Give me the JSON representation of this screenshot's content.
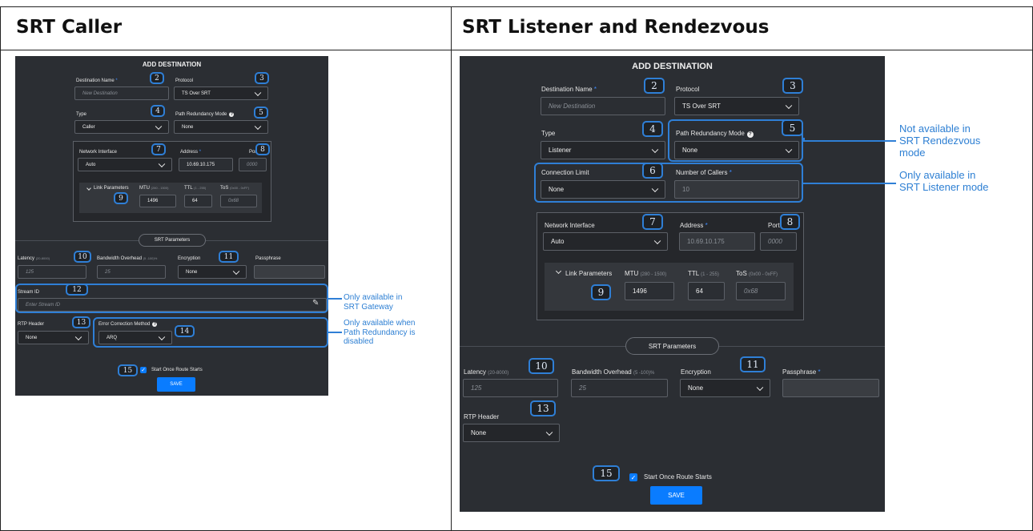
{
  "columns": {
    "left": "SRT Caller",
    "right": "SRT Listener and Rendezvous"
  },
  "caller": {
    "title": "ADD DESTINATION",
    "dest_name_label": "Destination Name",
    "dest_name_placeholder": "New Destination",
    "protocol_label": "Protocol",
    "protocol_value": "TS Over SRT",
    "type_label": "Type",
    "type_value": "Caller",
    "path_label": "Path Redundancy Mode",
    "path_value": "None",
    "net_label": "Network Interface",
    "net_value": "Auto",
    "addr_label": "Address",
    "addr_value": "10.69.10.175",
    "port_label": "Port",
    "port_placeholder": "0000",
    "lp_label": "Link Parameters",
    "mtu_label": "MTU",
    "mtu_hint": "(280 - 1500)",
    "mtu_value": "1496",
    "ttl_label": "TTL",
    "ttl_hint": "(1 - 255)",
    "ttl_value": "64",
    "tos_label": "ToS",
    "tos_hint": "(0x00 - 0xFF)",
    "tos_placeholder": "0x68",
    "srt_params": "SRT Parameters",
    "latency_label": "Latency",
    "latency_hint": "(20-8000)",
    "latency_placeholder": "125",
    "bw_label": "Bandwidth Overhead",
    "bw_hint": "(5 -100)%",
    "bw_placeholder": "25",
    "enc_label": "Encryption",
    "enc_value": "None",
    "pass_label": "Passphrase",
    "stream_label": "Stream ID",
    "stream_placeholder": "Enter Stream ID",
    "rtp_label": "RTP Header",
    "rtp_value": "None",
    "ecm_label": "Error Correction Method",
    "ecm_value": "ARQ",
    "start_label": "Start Once Route Starts",
    "save": "SAVE",
    "badges": [
      "2",
      "3",
      "4",
      "5",
      "7",
      "8",
      "9",
      "10",
      "11",
      "12",
      "13",
      "14",
      "15"
    ]
  },
  "listener": {
    "title": "ADD DESTINATION",
    "dest_name_label": "Destination Name",
    "dest_name_placeholder": "New Destination",
    "protocol_label": "Protocol",
    "protocol_value": "TS Over SRT",
    "type_label": "Type",
    "type_value": "Listener",
    "path_label": "Path Redundancy Mode",
    "path_value": "None",
    "conn_label": "Connection Limit",
    "conn_value": "None",
    "callers_label": "Number of Callers",
    "callers_placeholder": "10",
    "net_label": "Network Interface",
    "net_value": "Auto",
    "addr_label": "Address",
    "addr_placeholder": "10.69.10.175",
    "port_label": "Port",
    "port_placeholder": "0000",
    "lp_label": "Link Parameters",
    "mtu_label": "MTU",
    "mtu_hint": "(280 - 1500)",
    "mtu_value": "1496",
    "ttl_label": "TTL",
    "ttl_hint": "(1 - 255)",
    "ttl_value": "64",
    "tos_label": "ToS",
    "tos_hint": "(0x00 - 0xFF)",
    "tos_placeholder": "0x68",
    "srt_params": "SRT Parameters",
    "latency_label": "Latency",
    "latency_hint": "(20-8000)",
    "latency_placeholder": "125",
    "bw_label": "Bandwidth Overhead",
    "bw_hint": "(5 -100)%",
    "bw_placeholder": "25",
    "enc_label": "Encryption",
    "enc_value": "None",
    "pass_label": "Passphrase",
    "rtp_label": "RTP Header",
    "rtp_value": "None",
    "start_label": "Start Once Route Starts",
    "save": "SAVE",
    "badges": [
      "2",
      "3",
      "4",
      "5",
      "6",
      "7",
      "8",
      "9",
      "10",
      "11",
      "13",
      "15"
    ]
  },
  "notes": {
    "stream_id": [
      "Only available in",
      "SRT Gateway"
    ],
    "ecm": [
      "Only available when",
      "Path Redundancy  is",
      "disabled"
    ],
    "path_redundancy": [
      "Not available in",
      "SRT Rendezvous",
      "mode"
    ],
    "conn_limit": [
      "Only available in",
      "SRT Listener mode"
    ]
  },
  "colors": {
    "accent": "#0a7cff",
    "annotation": "#2f7fd6",
    "panel": "#2b2e33"
  }
}
